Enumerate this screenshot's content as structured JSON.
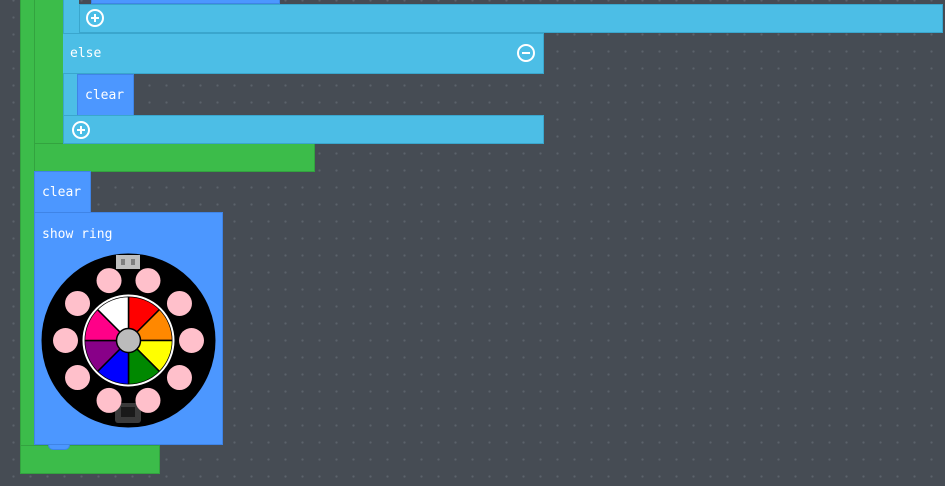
{
  "editor": {
    "if_else_block": {
      "else_label": "else",
      "else_body_label": "clear",
      "remove_else_icon": "minus-circle-icon",
      "add_else_if_icons": [
        "plus-circle-icon",
        "plus-circle-icon"
      ]
    },
    "clear_label": "clear",
    "show_ring": {
      "label": "show ring",
      "led_count": 10,
      "led_off_color": "#ffc0cb",
      "palette": [
        {
          "name": "red",
          "color": "#ff0000"
        },
        {
          "name": "orange",
          "color": "#ff8800"
        },
        {
          "name": "yellow",
          "color": "#ffff00"
        },
        {
          "name": "green",
          "color": "#008800"
        },
        {
          "name": "blue",
          "color": "#0000ff"
        },
        {
          "name": "purple",
          "color": "#880088"
        },
        {
          "name": "pink",
          "color": "#ff0088"
        },
        {
          "name": "white",
          "color": "#ffffff"
        }
      ]
    }
  },
  "colors": {
    "workspace": "#464c54",
    "loop_green": "#3cbc4a",
    "logic_cyan": "#4cbee6",
    "basic_blue": "#4c97ff"
  }
}
